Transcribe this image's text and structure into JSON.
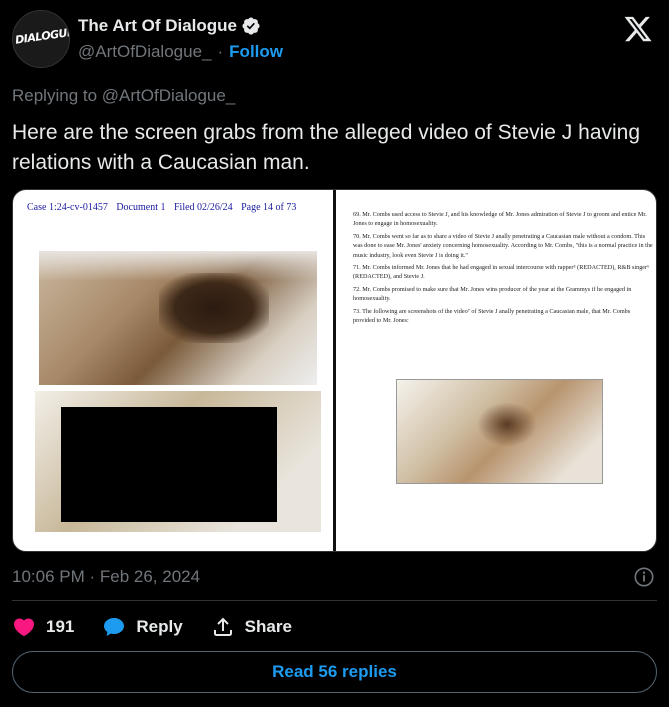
{
  "author": {
    "display_name": "The Art Of Dialogue",
    "handle": "@ArtOfDialogue_",
    "separator": "·",
    "follow_label": "Follow",
    "avatar_text": "DIALOGUE",
    "verified_icon": "verified-badge-icon"
  },
  "brand_icon": "x-logo-icon",
  "reply_context": "Replying to @ArtOfDialogue_",
  "tweet_text": "Here are the screen grabs from the alleged video of Stevie J having relations with a Caucasian man.",
  "media": {
    "doc_header": [
      "Case 1:24-cv-01457",
      "Document 1",
      "Filed 02/26/24",
      "Page 14 of 73"
    ],
    "paragraphs": [
      "69. Mr. Combs used access to Stevie J, and his knowledge of Mr. Jones admiration of Stevie J to groom and entice Mr. Jones to engage in homosexuality.",
      "70. Mr. Combs went so far as to share a video of Stevie J anally penetrating a Caucasian male without a condom. This was done to ease Mr. Jones' anxiety concerning homosexuality. According to Mr. Combs, \"this is a normal practice in the music industry, look even Stevie J is doing it.\"",
      "71. Mr. Combs informed Mr. Jones that he had engaged in sexual intercourse with rapper⁵ (REDACTED), R&B singer⁶ (REDACTED), and Stevie J.",
      "72. Mr. Combs promised to make sure that Mr. Jones wins producer of the year at the Grammys if he engaged in homosexuality.",
      "73. The following are screenshots of the video⁷ of Stevie J anally penetrating a Caucasian male, that Mr. Combs provided to Mr. Jones:"
    ]
  },
  "timestamp": "10:06 PM · Feb 26, 2024",
  "info_icon": "info-icon",
  "actions": {
    "likes_count": "191",
    "reply_label": "Reply",
    "share_label": "Share"
  },
  "read_replies_label": "Read 56 replies",
  "colors": {
    "background": "#000000",
    "text": "#e7e9ea",
    "muted": "#71767b",
    "accent": "#1d9bf0",
    "like": "#f91880"
  }
}
